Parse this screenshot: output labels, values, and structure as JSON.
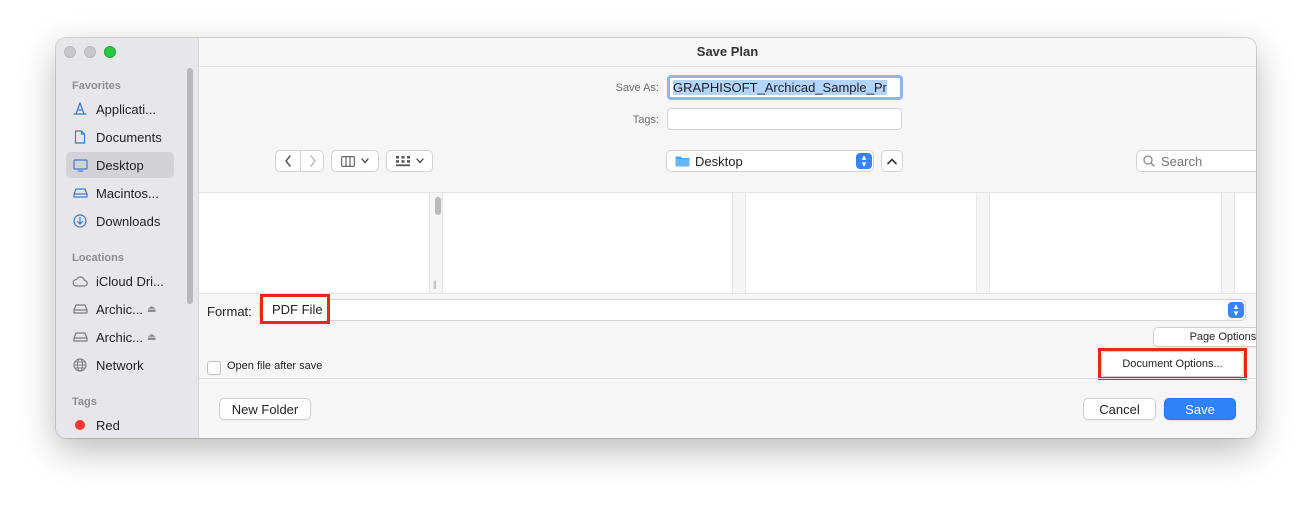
{
  "window": {
    "title": "Save Plan"
  },
  "sidebar": {
    "sections": [
      {
        "heading": "Favorites",
        "items": [
          {
            "label": "Applicati...",
            "icon": "applications-icon"
          },
          {
            "label": "Documents",
            "icon": "document-icon"
          },
          {
            "label": "Desktop",
            "icon": "desktop-icon",
            "selected": true
          },
          {
            "label": "Macintos...",
            "icon": "hard-drive-icon"
          },
          {
            "label": "Downloads",
            "icon": "download-icon"
          }
        ]
      },
      {
        "heading": "Locations",
        "items": [
          {
            "label": "iCloud Dri...",
            "icon": "cloud-icon"
          },
          {
            "label": "Archic...",
            "icon": "disk-icon",
            "eject": true
          },
          {
            "label": "Archic...",
            "icon": "disk-icon",
            "eject": true
          },
          {
            "label": "Network",
            "icon": "globe-icon"
          }
        ]
      },
      {
        "heading": "Tags",
        "items": [
          {
            "label": "Red",
            "icon": "red-tag-dot",
            "color": "#f13a2f"
          }
        ]
      }
    ]
  },
  "save_form": {
    "save_as_label": "Save As:",
    "save_as_value": "GRAPHISOFT_Archicad_Sample_Pr",
    "tags_label": "Tags:",
    "tags_value": ""
  },
  "toolbar": {
    "location": "Desktop",
    "search_placeholder": "Search"
  },
  "options": {
    "format_label": "Format:",
    "format_value": "PDF File",
    "page_options_label": "Page Options...",
    "document_options_label": "Document Options...",
    "open_after_save_label": "Open file after save",
    "open_after_save_checked": false
  },
  "footer": {
    "new_folder_label": "New Folder",
    "cancel_label": "Cancel",
    "save_label": "Save"
  },
  "colors": {
    "accent": "#2f82f7",
    "highlight_box": "#e8261c"
  }
}
